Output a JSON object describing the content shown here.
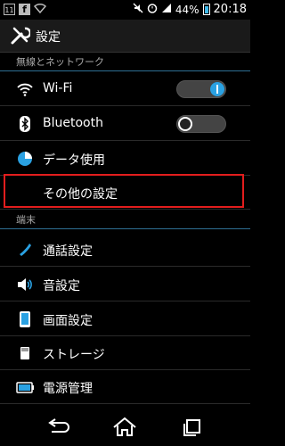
{
  "statusbar": {
    "notif_number": "11",
    "battery_percent": "44%",
    "time": "20:18"
  },
  "actionbar": {
    "title": "設定",
    "icon": "settings-tools-icon"
  },
  "sections": {
    "wireless": {
      "header": "無線とネットワーク",
      "items": [
        {
          "label": "Wi-Fi",
          "icon": "wifi-icon",
          "toggle": "on"
        },
        {
          "label": "Bluetooth",
          "icon": "bluetooth-icon",
          "toggle": "off"
        },
        {
          "label": "データ使用",
          "icon": "data-usage-icon"
        },
        {
          "label": "その他の設定",
          "icon": ""
        }
      ]
    },
    "device": {
      "header": "端末",
      "items": [
        {
          "label": "通話設定",
          "icon": "phone-icon"
        },
        {
          "label": "音設定",
          "icon": "speaker-icon"
        },
        {
          "label": "画面設定",
          "icon": "display-icon"
        },
        {
          "label": "ストレージ",
          "icon": "storage-icon"
        },
        {
          "label": "電源管理",
          "icon": "battery-icon"
        }
      ]
    }
  },
  "colors": {
    "accent": "#2aa1e2",
    "highlight": "#e21d1d"
  },
  "navbar": {
    "buttons": [
      "back-icon",
      "home-icon",
      "recent-apps-icon"
    ]
  }
}
